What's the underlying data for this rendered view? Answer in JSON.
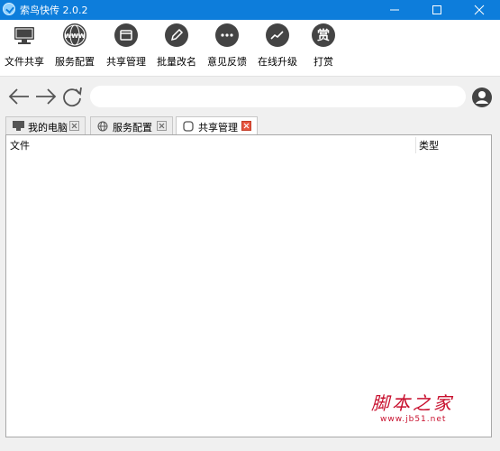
{
  "window": {
    "title": "索鸟快传 2.0.2"
  },
  "toolbar": {
    "items": [
      {
        "label": "文件共享",
        "icon": "monitor-icon"
      },
      {
        "label": "服务配置",
        "icon": "www-globe-icon"
      },
      {
        "label": "共享管理",
        "icon": "window-icon"
      },
      {
        "label": "批量改名",
        "icon": "pencil-icon"
      },
      {
        "label": "意见反馈",
        "icon": "chat-icon"
      },
      {
        "label": "在线升级",
        "icon": "trend-icon"
      },
      {
        "label": "打赏",
        "icon": "reward-icon",
        "glyph": "赏"
      }
    ],
    "www_text": "WWW"
  },
  "nav": {
    "address_value": ""
  },
  "tabs": [
    {
      "label": "我的电脑",
      "icon": "monitor-icon",
      "active": false
    },
    {
      "label": "服务配置",
      "icon": "globe-icon",
      "active": false
    },
    {
      "label": "共享管理",
      "icon": "window-icon",
      "active": true
    }
  ],
  "table": {
    "columns": [
      "文件",
      "类型"
    ],
    "rows": []
  },
  "watermark": {
    "main": "脚本之家",
    "url": "www.jb51.net"
  },
  "colors": {
    "titlebar": "#0d7ddb",
    "icon_dark": "#444444",
    "watermark": "#c8102e"
  }
}
